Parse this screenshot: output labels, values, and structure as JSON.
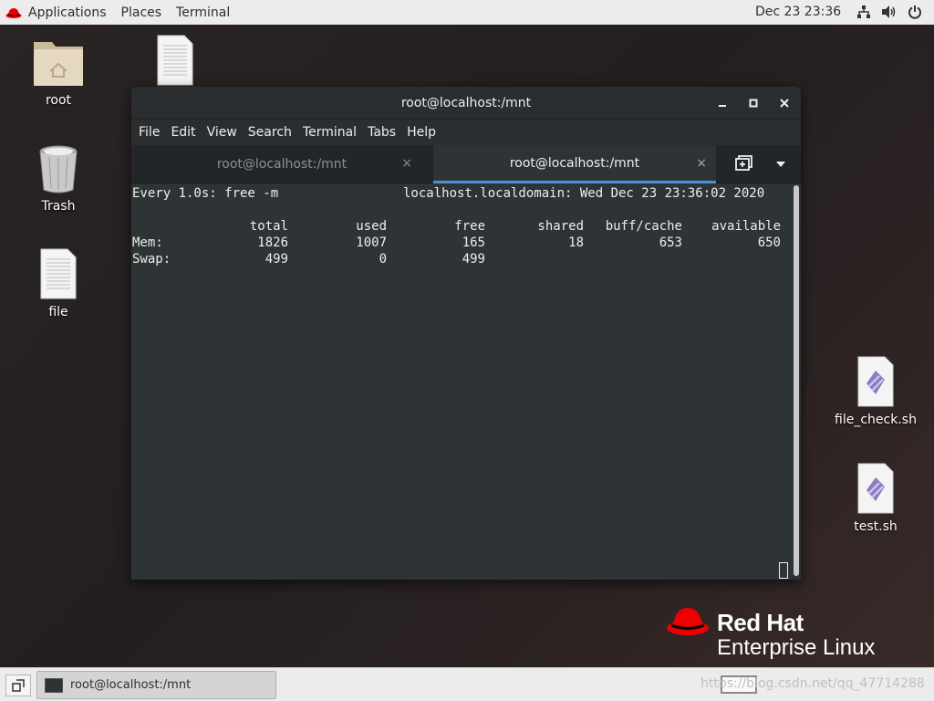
{
  "topbar": {
    "applications": "Applications",
    "places": "Places",
    "terminal": "Terminal",
    "clock": "Dec 23  23:36",
    "icons": [
      "network-icon",
      "volume-icon",
      "power-icon"
    ]
  },
  "desktop": {
    "icons": [
      {
        "label": "root",
        "icon": "home-folder-icon"
      },
      {
        "label": "",
        "icon": "document-icon"
      },
      {
        "label": "Trash",
        "icon": "trash-icon"
      },
      {
        "label": "file",
        "icon": "document-icon"
      },
      {
        "label": "file_check.sh",
        "icon": "script-icon"
      },
      {
        "label": "test.sh",
        "icon": "script-icon"
      }
    ]
  },
  "window": {
    "title": "root@localhost:/mnt",
    "controls": [
      "minimize-icon",
      "maximize-icon",
      "close-icon"
    ],
    "menu": [
      "File",
      "Edit",
      "View",
      "Search",
      "Terminal",
      "Tabs",
      "Help"
    ],
    "tabs": [
      {
        "label": "root@localhost:/mnt",
        "active": false
      },
      {
        "label": "root@localhost:/mnt",
        "active": true
      }
    ],
    "close_glyph": "×"
  },
  "terminal": {
    "header_left": "Every 1.0s: free -m",
    "header_right": "localhost.localdomain: Wed Dec 23 23:36:02 2020",
    "columns": [
      "total",
      "used",
      "free",
      "shared",
      "buff/cache",
      "available"
    ],
    "rows": [
      {
        "label": "Mem:",
        "values": [
          "1826",
          "1007",
          "165",
          "18",
          "653",
          "650"
        ]
      },
      {
        "label": "Swap:",
        "values": [
          "499",
          "0",
          "499",
          "",
          "",
          ""
        ]
      }
    ]
  },
  "branding": {
    "line1": "Red Hat",
    "line2": "Enterprise Linux",
    "color": "#ee0000"
  },
  "taskbar": {
    "task_label": "root@localhost:/mnt",
    "watermark": "https://blog.csdn.net/qq_47714288"
  }
}
